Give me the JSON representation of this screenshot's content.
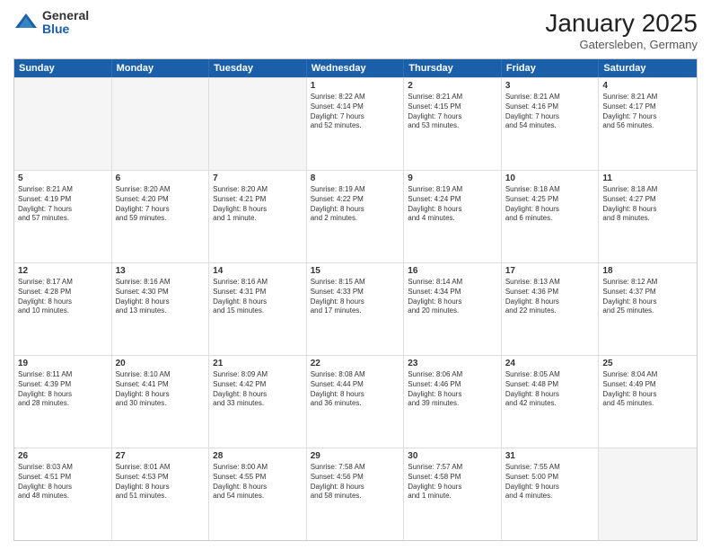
{
  "logo": {
    "general": "General",
    "blue": "Blue"
  },
  "title": "January 2025",
  "location": "Gatersleben, Germany",
  "header_days": [
    "Sunday",
    "Monday",
    "Tuesday",
    "Wednesday",
    "Thursday",
    "Friday",
    "Saturday"
  ],
  "rows": [
    [
      {
        "day": "",
        "text": "",
        "empty": true
      },
      {
        "day": "",
        "text": "",
        "empty": true
      },
      {
        "day": "",
        "text": "",
        "empty": true
      },
      {
        "day": "1",
        "text": "Sunrise: 8:22 AM\nSunset: 4:14 PM\nDaylight: 7 hours\nand 52 minutes."
      },
      {
        "day": "2",
        "text": "Sunrise: 8:21 AM\nSunset: 4:15 PM\nDaylight: 7 hours\nand 53 minutes."
      },
      {
        "day": "3",
        "text": "Sunrise: 8:21 AM\nSunset: 4:16 PM\nDaylight: 7 hours\nand 54 minutes."
      },
      {
        "day": "4",
        "text": "Sunrise: 8:21 AM\nSunset: 4:17 PM\nDaylight: 7 hours\nand 56 minutes."
      }
    ],
    [
      {
        "day": "5",
        "text": "Sunrise: 8:21 AM\nSunset: 4:19 PM\nDaylight: 7 hours\nand 57 minutes."
      },
      {
        "day": "6",
        "text": "Sunrise: 8:20 AM\nSunset: 4:20 PM\nDaylight: 7 hours\nand 59 minutes."
      },
      {
        "day": "7",
        "text": "Sunrise: 8:20 AM\nSunset: 4:21 PM\nDaylight: 8 hours\nand 1 minute."
      },
      {
        "day": "8",
        "text": "Sunrise: 8:19 AM\nSunset: 4:22 PM\nDaylight: 8 hours\nand 2 minutes."
      },
      {
        "day": "9",
        "text": "Sunrise: 8:19 AM\nSunset: 4:24 PM\nDaylight: 8 hours\nand 4 minutes."
      },
      {
        "day": "10",
        "text": "Sunrise: 8:18 AM\nSunset: 4:25 PM\nDaylight: 8 hours\nand 6 minutes."
      },
      {
        "day": "11",
        "text": "Sunrise: 8:18 AM\nSunset: 4:27 PM\nDaylight: 8 hours\nand 8 minutes."
      }
    ],
    [
      {
        "day": "12",
        "text": "Sunrise: 8:17 AM\nSunset: 4:28 PM\nDaylight: 8 hours\nand 10 minutes."
      },
      {
        "day": "13",
        "text": "Sunrise: 8:16 AM\nSunset: 4:30 PM\nDaylight: 8 hours\nand 13 minutes."
      },
      {
        "day": "14",
        "text": "Sunrise: 8:16 AM\nSunset: 4:31 PM\nDaylight: 8 hours\nand 15 minutes."
      },
      {
        "day": "15",
        "text": "Sunrise: 8:15 AM\nSunset: 4:33 PM\nDaylight: 8 hours\nand 17 minutes."
      },
      {
        "day": "16",
        "text": "Sunrise: 8:14 AM\nSunset: 4:34 PM\nDaylight: 8 hours\nand 20 minutes."
      },
      {
        "day": "17",
        "text": "Sunrise: 8:13 AM\nSunset: 4:36 PM\nDaylight: 8 hours\nand 22 minutes."
      },
      {
        "day": "18",
        "text": "Sunrise: 8:12 AM\nSunset: 4:37 PM\nDaylight: 8 hours\nand 25 minutes."
      }
    ],
    [
      {
        "day": "19",
        "text": "Sunrise: 8:11 AM\nSunset: 4:39 PM\nDaylight: 8 hours\nand 28 minutes."
      },
      {
        "day": "20",
        "text": "Sunrise: 8:10 AM\nSunset: 4:41 PM\nDaylight: 8 hours\nand 30 minutes."
      },
      {
        "day": "21",
        "text": "Sunrise: 8:09 AM\nSunset: 4:42 PM\nDaylight: 8 hours\nand 33 minutes."
      },
      {
        "day": "22",
        "text": "Sunrise: 8:08 AM\nSunset: 4:44 PM\nDaylight: 8 hours\nand 36 minutes."
      },
      {
        "day": "23",
        "text": "Sunrise: 8:06 AM\nSunset: 4:46 PM\nDaylight: 8 hours\nand 39 minutes."
      },
      {
        "day": "24",
        "text": "Sunrise: 8:05 AM\nSunset: 4:48 PM\nDaylight: 8 hours\nand 42 minutes."
      },
      {
        "day": "25",
        "text": "Sunrise: 8:04 AM\nSunset: 4:49 PM\nDaylight: 8 hours\nand 45 minutes."
      }
    ],
    [
      {
        "day": "26",
        "text": "Sunrise: 8:03 AM\nSunset: 4:51 PM\nDaylight: 8 hours\nand 48 minutes."
      },
      {
        "day": "27",
        "text": "Sunrise: 8:01 AM\nSunset: 4:53 PM\nDaylight: 8 hours\nand 51 minutes."
      },
      {
        "day": "28",
        "text": "Sunrise: 8:00 AM\nSunset: 4:55 PM\nDaylight: 8 hours\nand 54 minutes."
      },
      {
        "day": "29",
        "text": "Sunrise: 7:58 AM\nSunset: 4:56 PM\nDaylight: 8 hours\nand 58 minutes."
      },
      {
        "day": "30",
        "text": "Sunrise: 7:57 AM\nSunset: 4:58 PM\nDaylight: 9 hours\nand 1 minute."
      },
      {
        "day": "31",
        "text": "Sunrise: 7:55 AM\nSunset: 5:00 PM\nDaylight: 9 hours\nand 4 minutes."
      },
      {
        "day": "",
        "text": "",
        "empty": true
      }
    ]
  ]
}
